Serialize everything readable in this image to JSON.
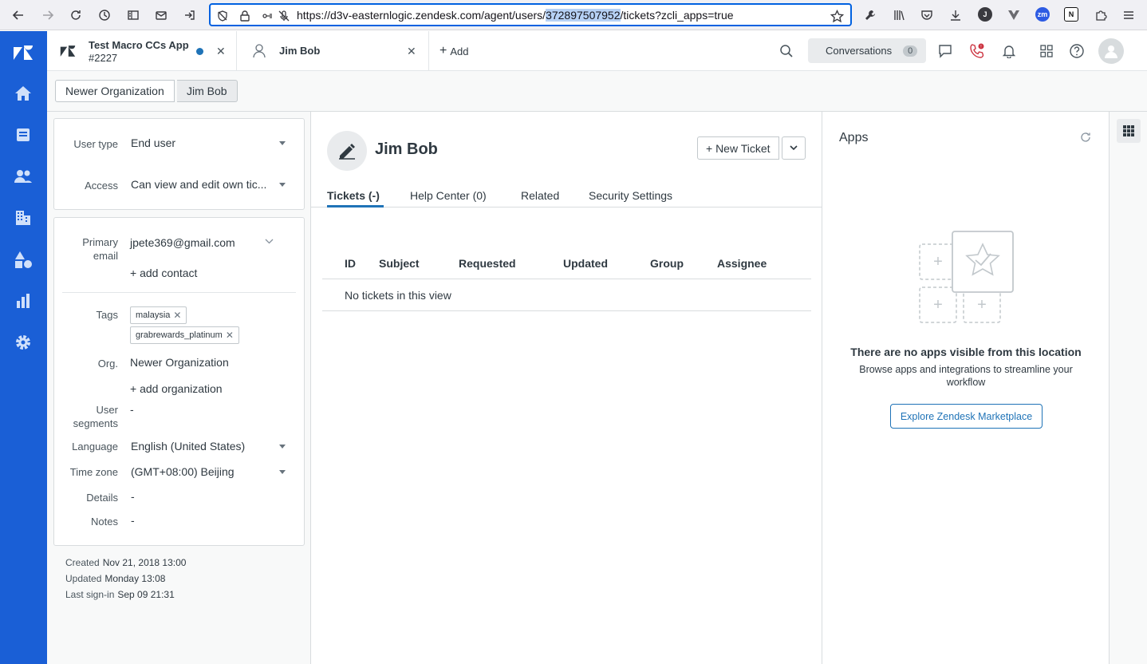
{
  "browser": {
    "url_prefix": "https://d3v-easternlogic.zendesk.com/agent/users/",
    "url_selected": "372897507952",
    "url_suffix": "/tickets?zcli_apps=true",
    "ext_j": "J",
    "ext_zm": "zm",
    "ext_n": "N"
  },
  "tabs": [
    {
      "title": "Test Macro CCs App",
      "subtitle": "#2227"
    },
    {
      "title": "Jim Bob"
    }
  ],
  "add_tab_label": "Add",
  "conversations": {
    "label": "Conversations",
    "count": "0"
  },
  "breadcrumb": [
    "Newer Organization",
    "Jim Bob"
  ],
  "user_fields": {
    "user_type": {
      "label": "User type",
      "value": "End user"
    },
    "access": {
      "label": "Access",
      "value": "Can view and edit own tic..."
    },
    "primary_email": {
      "label_1": "Primary",
      "label_2": "email",
      "value": "jpete369@gmail.com"
    },
    "add_contact": "+ add contact",
    "tags": {
      "label": "Tags",
      "items": [
        "malaysia",
        "grabrewards_platinum"
      ]
    },
    "org": {
      "label": "Org.",
      "value": "Newer Organization"
    },
    "add_org": "+ add organization",
    "segments": {
      "label_1": "User",
      "label_2": "segments",
      "value": "-"
    },
    "language": {
      "label": "Language",
      "value": "English (United States)"
    },
    "timezone": {
      "label": "Time zone",
      "value": "(GMT+08:00) Beijing"
    },
    "details": {
      "label": "Details",
      "value": "-"
    },
    "notes": {
      "label": "Notes",
      "value": "-"
    }
  },
  "meta": {
    "created": {
      "label": "Created",
      "value": "Nov 21, 2018 13:00"
    },
    "updated": {
      "label": "Updated",
      "value": "Monday 13:08"
    },
    "last_signin": {
      "label": "Last sign-in",
      "value": "Sep 09 21:31"
    }
  },
  "main": {
    "user_name": "Jim Bob",
    "new_ticket": "+ New Ticket",
    "tabs": [
      "Tickets (-)",
      "Help Center (0)",
      "Related",
      "Security Settings"
    ],
    "columns": [
      "ID",
      "Subject",
      "Requested",
      "Updated",
      "Group",
      "Assignee"
    ],
    "empty_text": "No tickets in this view"
  },
  "apps": {
    "title": "Apps",
    "empty_title": "There are no apps visible from this location",
    "empty_sub": "Browse apps and integrations to streamline your workflow",
    "marketplace_button": "Explore Zendesk Marketplace"
  },
  "colors": {
    "nav_bg": "#1a5fd6",
    "accent": "#1f73b7",
    "notification_red": "#cc3340"
  }
}
